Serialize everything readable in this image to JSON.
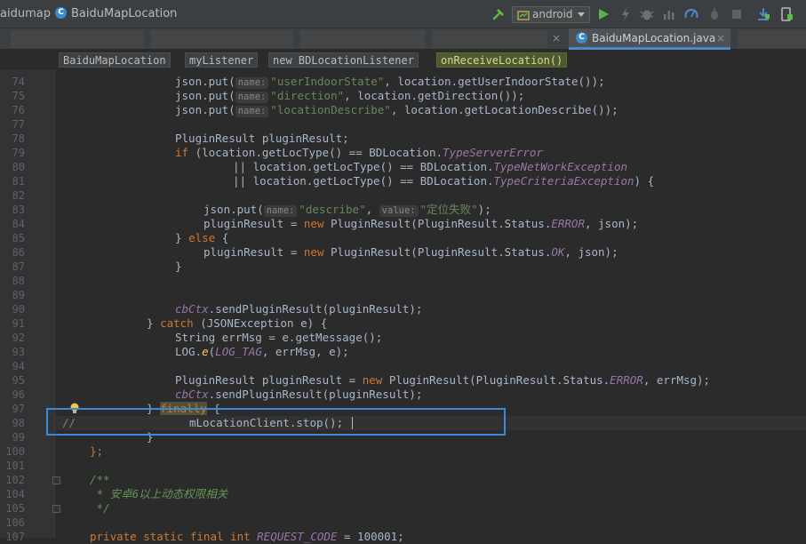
{
  "toolbar": {
    "breadcrumb_project": "aidumap",
    "breadcrumb_file": "BaiduMapLocation",
    "run_config": "android",
    "icons": [
      "hammer-icon",
      "run-icon",
      "debug-icon",
      "attach-debugger-icon",
      "coverage-icon",
      "profile-icon",
      "stop-icon",
      "sdk-manager-icon",
      "avd-manager-icon"
    ]
  },
  "tabs": {
    "active": "BaiduMapLocation.java",
    "close_glyph": "×"
  },
  "editor_breadcrumbs": [
    "BaiduMapLocation",
    "myListener",
    "new BDLocationListener",
    "onReceiveLocation()"
  ],
  "code": {
    "line_numbers": [
      "74",
      "75",
      "76",
      "77",
      "78",
      "79",
      "80",
      "81",
      "82",
      "83",
      "84",
      "85",
      "86",
      "87",
      "88",
      "89",
      "90",
      "91",
      "92",
      "93",
      "94",
      "95",
      "96",
      "97",
      "98",
      "99",
      "100",
      "101",
      "102",
      "104",
      "105",
      "106",
      "107"
    ],
    "l74_a": "json.put(",
    "l74_hint": "name:",
    "l74_str": "\"userIndoorState\"",
    "l74_b": ", location.getUserIndoorState());",
    "l75_a": "json.put(",
    "l75_hint": "name:",
    "l75_str": "\"direction\"",
    "l75_b": ", location.getDirection());",
    "l76_a": "json.put(",
    "l76_hint": "name:",
    "l76_str": "\"locationDescribe\"",
    "l76_b": ", location.getLocationDescribe());",
    "l78": "PluginResult pluginResult;",
    "l79_kw": "if",
    "l79_a": " (location.getLocType() == BDLocation.",
    "l79_it": "TypeServerError",
    "l80_a": "|| location.getLocType() == BDLocation.",
    "l80_it": "TypeNetWorkException",
    "l81_a": "|| location.getLocType() == BDLocation.",
    "l81_it": "TypeCriteriaException",
    "l81_b": ") {",
    "l83_a": "json.put(",
    "l83_hint1": "name:",
    "l83_str1": "\"describe\"",
    "l83_b": ", ",
    "l83_hint2": "value:",
    "l83_str2": "\"定位失败\"",
    "l83_c": ");",
    "l84_a": "pluginResult = ",
    "l84_kw": "new",
    "l84_b": " PluginResult(PluginResult.Status.",
    "l84_it": "ERROR",
    "l84_c": ", json);",
    "l85_a": "} ",
    "l85_kw": "else",
    "l85_b": " {",
    "l86_a": "pluginResult = ",
    "l86_kw": "new",
    "l86_b": " PluginResult(PluginResult.Status.",
    "l86_it": "OK",
    "l86_c": ", json);",
    "l87": "}",
    "l90_it": "cbCtx",
    "l90_b": ".sendPluginResult(pluginResult);",
    "l91_a": "} ",
    "l91_kw": "catch",
    "l91_b": " (JSONException e) {",
    "l92": "String errMsg = e.getMessage();",
    "l93_a": "LOG.",
    "l93_fn": "e",
    "l93_b": "(",
    "l93_it": "LOG_TAG",
    "l93_c": ", errMsg, e);",
    "l95_a": "PluginResult pluginResult = ",
    "l95_kw": "new",
    "l95_b": " PluginResult(PluginResult.Status.",
    "l95_it": "ERROR",
    "l95_c": ", errMsg);",
    "l96_it": "cbCtx",
    "l96_b": ".sendPluginResult(pluginResult);",
    "l97_a": "} ",
    "l97_kw": "finally",
    "l97_b": " {",
    "l98_cm": "//",
    "l98_code": "mLocationClient.stop();",
    "l99": "}",
    "l100": "};",
    "l104": "/**",
    "l105": " * 安卓6以上动态权限相关",
    "l106": " */",
    "l107_kw": "private static final int",
    "l107_it": "REQUEST_CODE",
    "l107_b": " = 100001;"
  }
}
